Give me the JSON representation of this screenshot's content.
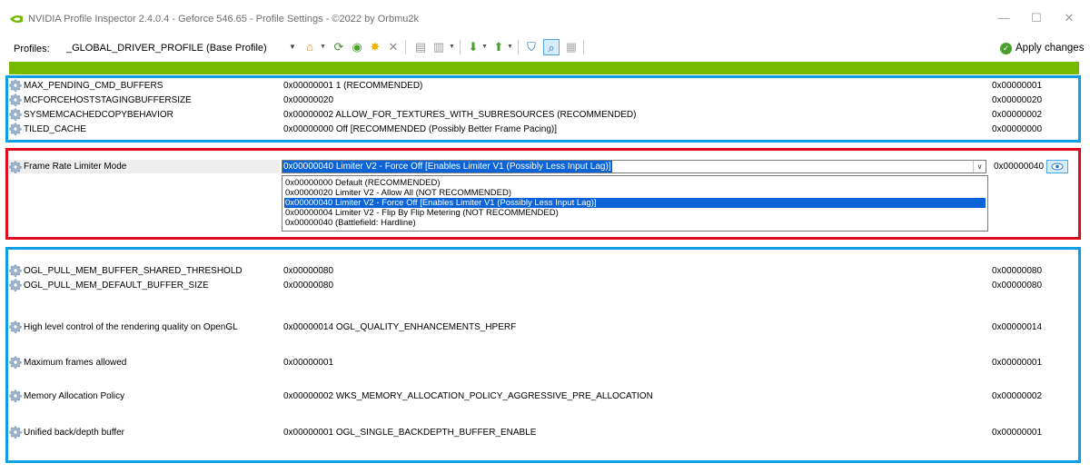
{
  "window": {
    "title": "NVIDIA Profile Inspector 2.4.0.4 - Geforce 546.65 - Profile Settings - ©2022 by Orbmu2k",
    "min": "—",
    "max": "☐",
    "close": "✕"
  },
  "toolbar": {
    "profiles_label": "Profiles:",
    "profile_value": "_GLOBAL_DRIVER_PROFILE (Base Profile)",
    "apply_label": "Apply changes"
  },
  "colors": {
    "accent_green": "#76b900",
    "panel_blue": "#0d9fe6",
    "panel_red": "#e10a1e",
    "selection": "#0a64d7"
  },
  "group_top": [
    {
      "name": "MAX_PENDING_CMD_BUFFERS",
      "value": "0x00000001 1 (RECOMMENDED)",
      "hex": "0x00000001"
    },
    {
      "name": "MCFORCEHOSTSTAGINGBUFFERSIZE",
      "value": "0x00000020",
      "hex": "0x00000020"
    },
    {
      "name": "SYSMEMCACHEDCOPYBEHAVIOR",
      "value": "0x00000002 ALLOW_FOR_TEXTURES_WITH_SUBRESOURCES (RECOMMENDED)",
      "hex": "0x00000002"
    },
    {
      "name": "TILED_CACHE",
      "value": "0x00000000 Off [RECOMMENDED (Possibly Better Frame Pacing)]",
      "hex": "0x00000000"
    }
  ],
  "frame_rate": {
    "name": "Frame Rate Limiter Mode",
    "selected": "0x00000040 Limiter V2 - Force Off [Enables Limiter V1 (Possibly Less Input Lag)]",
    "hex": "0x00000040",
    "options": [
      "0x00000000 Default (RECOMMENDED)",
      "0x00000020 Limiter V2 - Allow All (NOT RECOMMENDED)",
      "0x00000040 Limiter V2 - Force Off [Enables Limiter V1 (Possibly Less Input Lag)]",
      "0x00000004 Limiter V2 - Flip By Flip Metering (NOT RECOMMENDED)",
      "0x00000040 (Battlefield: Hardline)"
    ]
  },
  "group_bottom": [
    {
      "name": "OGL_PULL_MEM_BUFFER_SHARED_THRESHOLD",
      "value": "0x00000080",
      "hex": "0x00000080"
    },
    {
      "name": "OGL_PULL_MEM_DEFAULT_BUFFER_SIZE",
      "value": "0x00000080",
      "hex": "0x00000080"
    },
    {
      "name": "High level control of the rendering quality on OpenGL",
      "value": "0x00000014 OGL_QUALITY_ENHANCEMENTS_HPERF",
      "hex": "0x00000014"
    },
    {
      "name": "Maximum frames allowed",
      "value": "0x00000001",
      "hex": "0x00000001"
    },
    {
      "name": "Memory Allocation Policy",
      "value": "0x00000002 WKS_MEMORY_ALLOCATION_POLICY_AGGRESSIVE_PRE_ALLOCATION",
      "hex": "0x00000002"
    },
    {
      "name": "Unified back/depth buffer",
      "value": "0x00000001 OGL_SINGLE_BACKDEPTH_BUFFER_ENABLE",
      "hex": "0x00000001"
    }
  ]
}
